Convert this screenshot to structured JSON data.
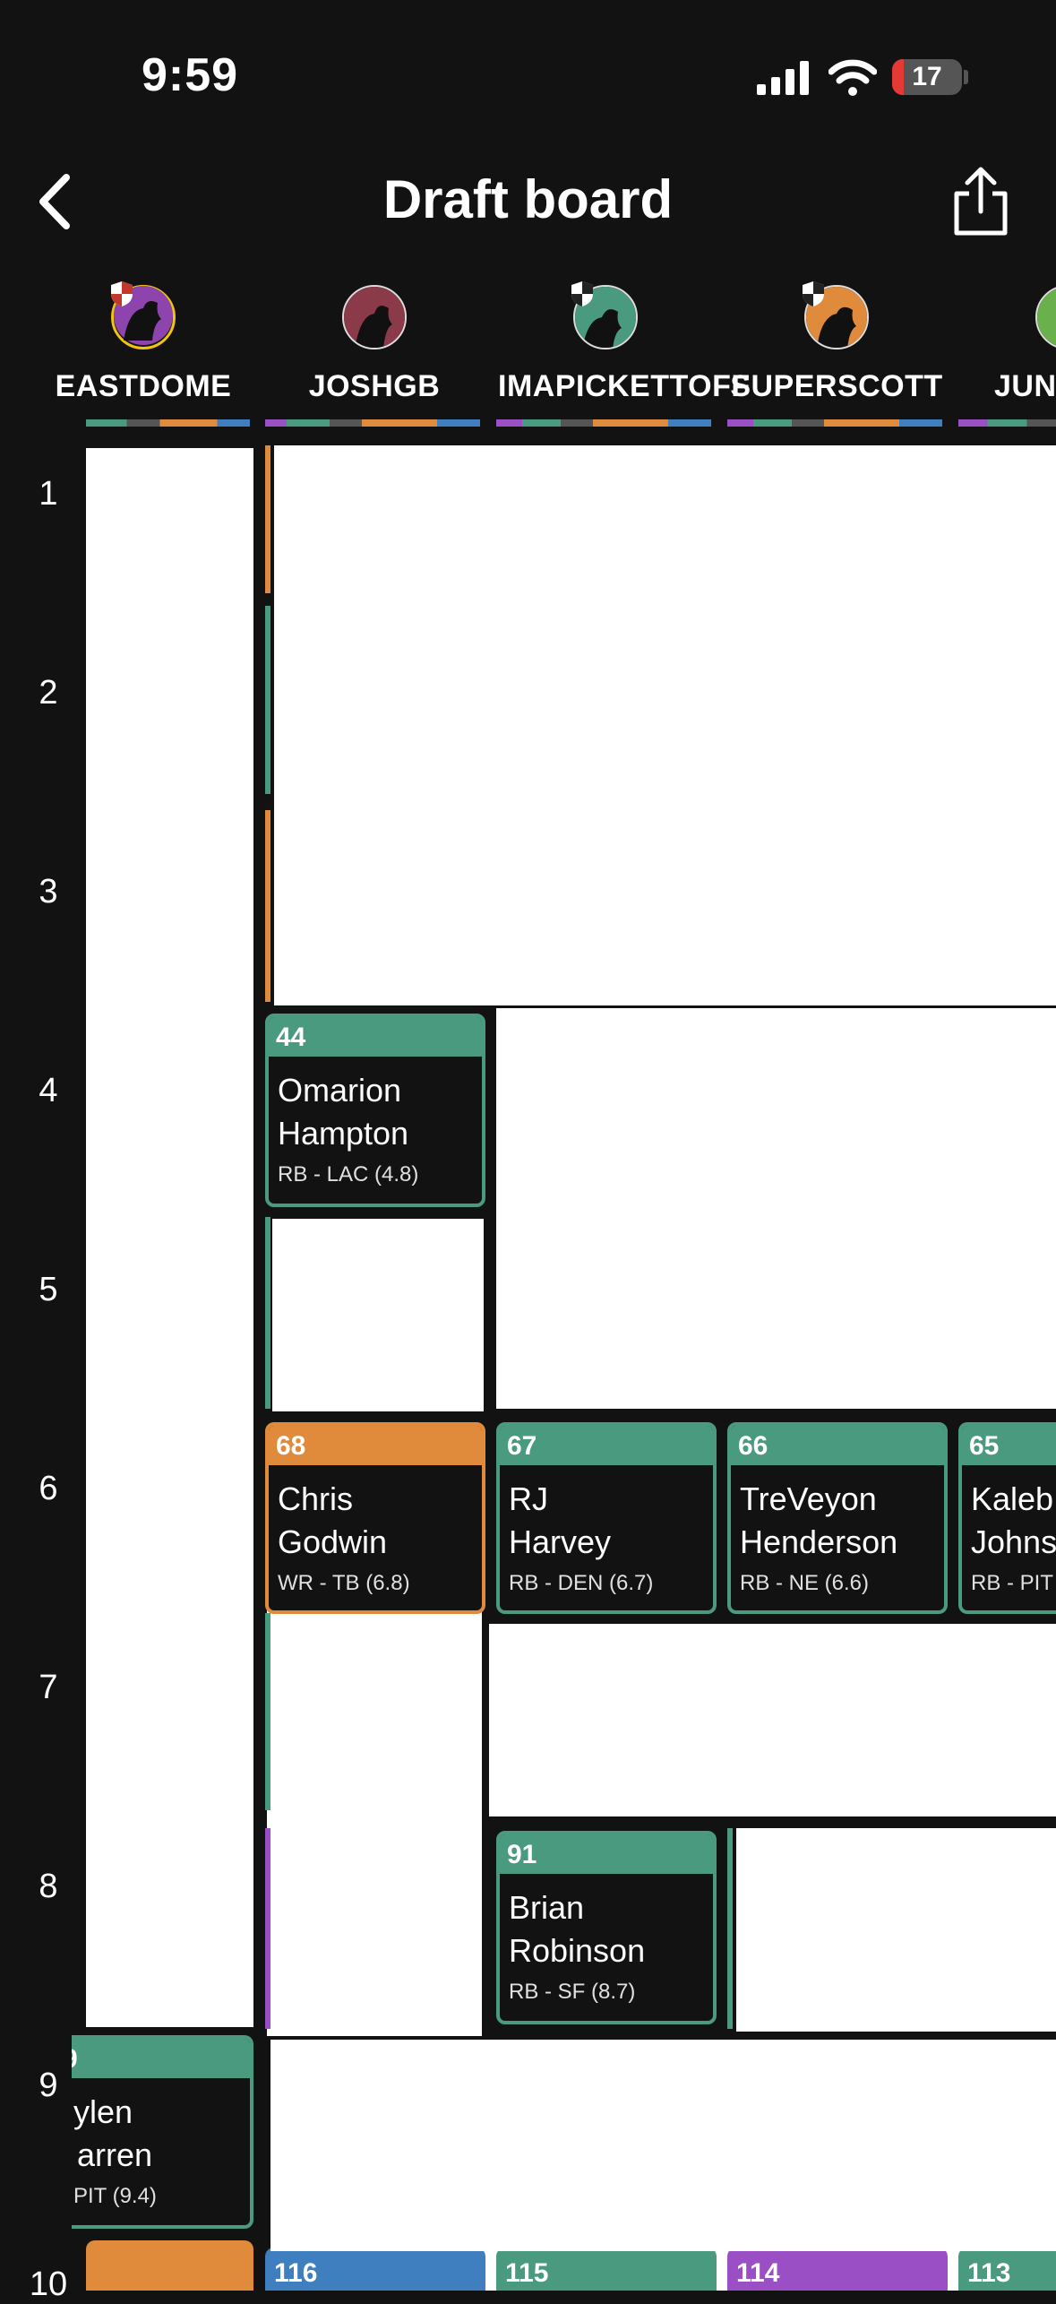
{
  "status_bar": {
    "time": "9:59",
    "battery": "17",
    "battery_level": 0.17,
    "battery_color": "#e53935"
  },
  "nav": {
    "back_icon": "chevron-left-icon",
    "title": "Draft board",
    "share_icon": "share-icon"
  },
  "teams": [
    {
      "name": "EASTDOME",
      "avatar_color": "#8e44ad",
      "avatar_border": "#f1c40f"
    },
    {
      "name": "JOSHGB",
      "avatar_color": "#8b3a4a"
    },
    {
      "name": "IMAPICKETTOFF",
      "avatar_color": "#4a9a80"
    },
    {
      "name": "SUPERSCOTT",
      "avatar_color": "#e08a3c"
    },
    {
      "name": "JUNG",
      "avatar_color": "#6ab04c"
    }
  ],
  "rounds": [
    "1",
    "2",
    "3",
    "4",
    "5",
    "6",
    "7",
    "8",
    "9",
    "10"
  ],
  "position_colors": {
    "RB": "#4a9a80",
    "WR": "#e08a3c",
    "QB": "#9b4fc4",
    "TE": "#3f7fbf"
  },
  "picks": {
    "p44": {
      "number": "44",
      "first": "Omarion",
      "last": "Hampton",
      "info": "RB - LAC (4.8)",
      "color": "#4a9a80"
    },
    "p68": {
      "number": "68",
      "first": "Chris",
      "last": "Godwin",
      "info": "WR - TB (6.8)",
      "color": "#e08a3c"
    },
    "p67": {
      "number": "67",
      "first": "RJ",
      "last": "Harvey",
      "info": "RB - DEN (6.7)",
      "color": "#4a9a80"
    },
    "p66": {
      "number": "66",
      "first": "TreVeyon",
      "last": "Henderson",
      "info": "RB - NE (6.6)",
      "color": "#4a9a80"
    },
    "p65": {
      "number": "65",
      "first": "Kaleb",
      "last": "Johns",
      "info": "RB - PIT (",
      "color": "#4a9a80"
    },
    "p91": {
      "number": "91",
      "first": "Brian",
      "last": "Robinson",
      "info": "RB - SF (8.7)",
      "color": "#4a9a80"
    },
    "p9x": {
      "number": "9",
      "first": "ylen",
      "last": "arren",
      "info": "PIT (9.4)",
      "color": "#4a9a80"
    },
    "p116": {
      "number": "116",
      "color": "#3f7fbf"
    },
    "p115": {
      "number": "115",
      "color": "#4a9a80"
    },
    "p114": {
      "number": "114",
      "color": "#9b4fc4"
    },
    "p113": {
      "number": "113",
      "color": "#4a9a80"
    }
  }
}
